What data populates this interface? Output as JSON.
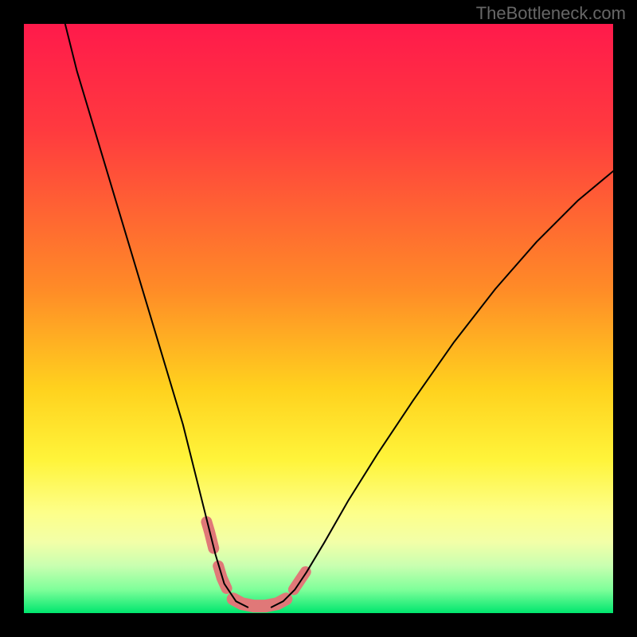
{
  "watermark": "TheBottleneck.com",
  "chart_data": {
    "type": "line",
    "title": "",
    "xlabel": "",
    "ylabel": "",
    "xlim": [
      0,
      100
    ],
    "ylim": [
      0,
      100
    ],
    "gradient_stops": [
      {
        "offset": 0,
        "color": "#ff1a4b"
      },
      {
        "offset": 18,
        "color": "#ff3a3f"
      },
      {
        "offset": 45,
        "color": "#ff8b27"
      },
      {
        "offset": 62,
        "color": "#ffd21e"
      },
      {
        "offset": 74,
        "color": "#fff43a"
      },
      {
        "offset": 83,
        "color": "#fdff8a"
      },
      {
        "offset": 88,
        "color": "#f2ffa8"
      },
      {
        "offset": 92,
        "color": "#c8ffb0"
      },
      {
        "offset": 96,
        "color": "#7fff9a"
      },
      {
        "offset": 100,
        "color": "#00e66e"
      }
    ],
    "series": [
      {
        "name": "curve-left",
        "stroke": "#000000",
        "stroke_width": 2,
        "points": [
          {
            "x": 7.0,
            "y": 100.0
          },
          {
            "x": 9.0,
            "y": 92.0
          },
          {
            "x": 12.0,
            "y": 82.0
          },
          {
            "x": 15.0,
            "y": 72.0
          },
          {
            "x": 18.0,
            "y": 62.0
          },
          {
            "x": 21.0,
            "y": 52.0
          },
          {
            "x": 24.0,
            "y": 42.0
          },
          {
            "x": 27.0,
            "y": 32.0
          },
          {
            "x": 29.0,
            "y": 24.0
          },
          {
            "x": 31.0,
            "y": 16.0
          },
          {
            "x": 32.5,
            "y": 10.0
          },
          {
            "x": 34.0,
            "y": 5.0
          },
          {
            "x": 36.0,
            "y": 2.0
          },
          {
            "x": 38.0,
            "y": 1.0
          }
        ]
      },
      {
        "name": "curve-right",
        "stroke": "#000000",
        "stroke_width": 2,
        "points": [
          {
            "x": 42.0,
            "y": 1.0
          },
          {
            "x": 44.0,
            "y": 2.0
          },
          {
            "x": 46.0,
            "y": 4.0
          },
          {
            "x": 48.0,
            "y": 7.0
          },
          {
            "x": 51.0,
            "y": 12.0
          },
          {
            "x": 55.0,
            "y": 19.0
          },
          {
            "x": 60.0,
            "y": 27.0
          },
          {
            "x": 66.0,
            "y": 36.0
          },
          {
            "x": 73.0,
            "y": 46.0
          },
          {
            "x": 80.0,
            "y": 55.0
          },
          {
            "x": 87.0,
            "y": 63.0
          },
          {
            "x": 94.0,
            "y": 70.0
          },
          {
            "x": 100.0,
            "y": 75.0
          }
        ]
      }
    ],
    "markers": [
      {
        "name": "markers-left-upper",
        "color": "#e07878",
        "stroke_width": 14,
        "points": [
          {
            "x": 31.0,
            "y": 15.5
          },
          {
            "x": 31.5,
            "y": 13.8
          },
          {
            "x": 32.2,
            "y": 11.0
          }
        ]
      },
      {
        "name": "markers-left-lower",
        "color": "#e07878",
        "stroke_width": 14,
        "points": [
          {
            "x": 33.0,
            "y": 8.0
          },
          {
            "x": 33.6,
            "y": 6.0
          },
          {
            "x": 34.4,
            "y": 4.2
          }
        ]
      },
      {
        "name": "markers-right-upper",
        "color": "#e07878",
        "stroke_width": 14,
        "points": [
          {
            "x": 45.8,
            "y": 4.0
          },
          {
            "x": 46.8,
            "y": 5.5
          },
          {
            "x": 47.8,
            "y": 7.0
          }
        ]
      },
      {
        "name": "markers-bottom-bridge",
        "color": "#e07878",
        "stroke_width": 16,
        "points": [
          {
            "x": 35.5,
            "y": 2.4
          },
          {
            "x": 37.0,
            "y": 1.6
          },
          {
            "x": 39.0,
            "y": 1.2
          },
          {
            "x": 41.0,
            "y": 1.2
          },
          {
            "x": 43.0,
            "y": 1.6
          },
          {
            "x": 44.5,
            "y": 2.4
          }
        ]
      }
    ]
  }
}
